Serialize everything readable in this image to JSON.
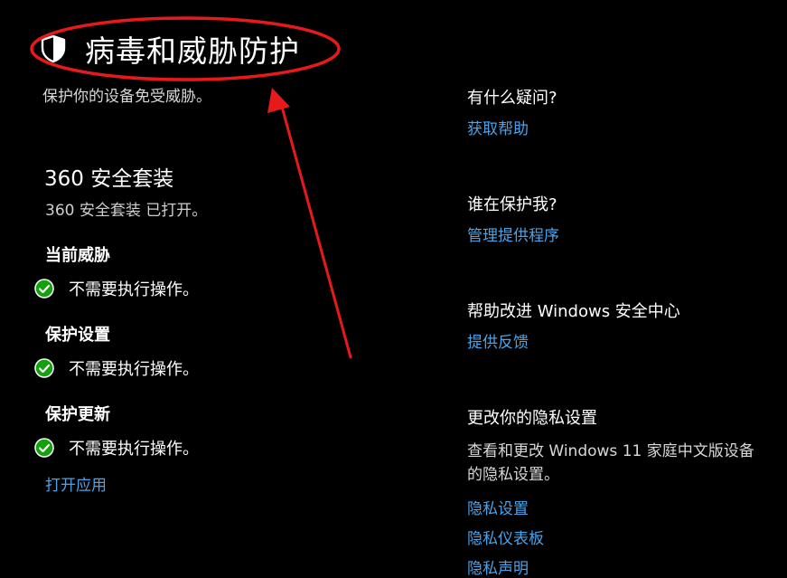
{
  "header": {
    "title": "病毒和威胁防护",
    "subtitle": "保护你的设备免受威胁。",
    "icon": "shield-icon"
  },
  "provider": {
    "name": "360 安全套装",
    "status": "360 安全套装 已打开。"
  },
  "groups": [
    {
      "heading": "当前威胁",
      "status": "不需要执行操作。"
    },
    {
      "heading": "保护设置",
      "status": "不需要执行操作。"
    },
    {
      "heading": "保护更新",
      "status": "不需要执行操作。"
    }
  ],
  "open_app_link": "打开应用",
  "sidebar": {
    "question_heading": "有什么疑问?",
    "get_help_link": "获取帮助",
    "who_protects_heading": "谁在保护我?",
    "manage_providers_link": "管理提供程序",
    "improve_heading": "帮助改进 Windows 安全中心",
    "feedback_link": "提供反馈",
    "privacy_heading": "更改你的隐私设置",
    "privacy_text": "查看和更改 Windows 11 家庭中文版设备的隐私设置。",
    "privacy_settings_link": "隐私设置",
    "privacy_dashboard_link": "隐私仪表板",
    "privacy_statement_link": "隐私声明"
  },
  "colors": {
    "background": "#000000",
    "link": "#4aa3e8",
    "check_green": "#13a10e",
    "annotation_red": "#e8191a"
  }
}
